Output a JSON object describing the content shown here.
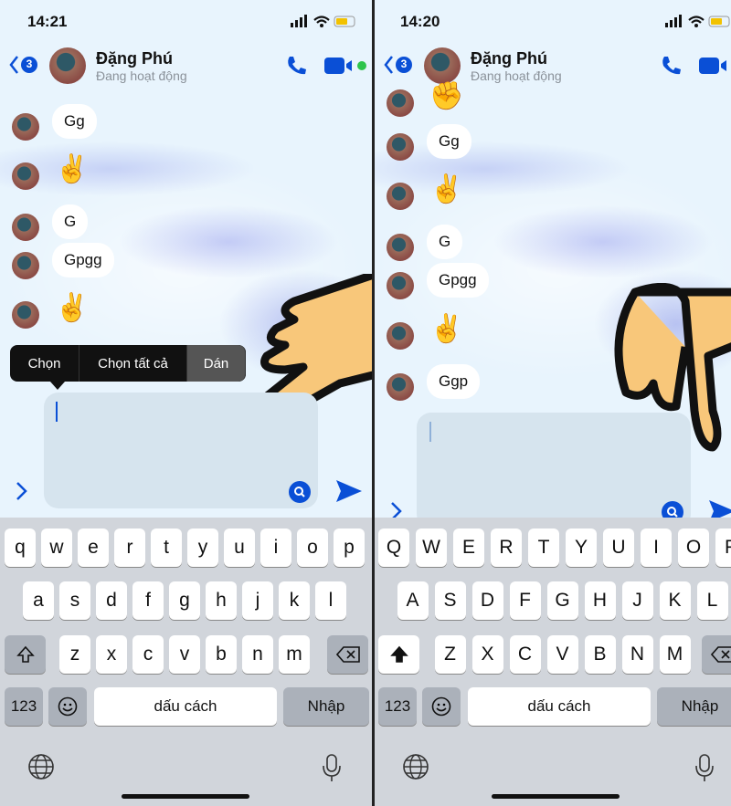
{
  "colors": {
    "accent": "#0a4fd6",
    "online": "#2ec44c",
    "keyboard": "#d1d5db"
  },
  "panels": [
    {
      "time": "14:21",
      "back_badge": "3",
      "contact_name": "Đặng Phú",
      "contact_status": "Đang hoạt động",
      "messages": [
        {
          "type": "text",
          "text": "Gg"
        },
        {
          "type": "emoji",
          "text": "✌️"
        },
        {
          "type": "text",
          "text": "G"
        },
        {
          "type": "text",
          "text": "Gpgg"
        },
        {
          "type": "emoji",
          "text": "✌️"
        }
      ],
      "context_menu": [
        "Chọn",
        "Chọn tất cả",
        "Dán"
      ],
      "keys": [
        [
          "q",
          "w",
          "e",
          "r",
          "t",
          "y",
          "u",
          "i",
          "o",
          "p"
        ],
        [
          "a",
          "s",
          "d",
          "f",
          "g",
          "h",
          "j",
          "k",
          "l"
        ],
        [
          "z",
          "x",
          "c",
          "v",
          "b",
          "n",
          "m"
        ]
      ],
      "shift_active": false,
      "num_label": "123",
      "space_label": "dấu cách",
      "return_label": "Nhập"
    },
    {
      "time": "14:20",
      "back_badge": "3",
      "contact_name": "Đặng Phú",
      "contact_status": "Đang hoạt động",
      "messages": [
        {
          "type": "emoji",
          "text": "✊"
        },
        {
          "type": "text",
          "text": "Gg"
        },
        {
          "type": "emoji",
          "text": "✌️"
        },
        {
          "type": "text",
          "text": "G"
        },
        {
          "type": "text",
          "text": "Gpgg"
        },
        {
          "type": "emoji",
          "text": "✌️"
        },
        {
          "type": "text",
          "text": "Ggp"
        }
      ],
      "keys": [
        [
          "Q",
          "W",
          "E",
          "R",
          "T",
          "Y",
          "U",
          "I",
          "O",
          "P"
        ],
        [
          "A",
          "S",
          "D",
          "F",
          "G",
          "H",
          "J",
          "K",
          "L"
        ],
        [
          "Z",
          "X",
          "C",
          "V",
          "B",
          "N",
          "M"
        ]
      ],
      "shift_active": true,
      "num_label": "123",
      "space_label": "dấu cách",
      "return_label": "Nhập"
    }
  ]
}
